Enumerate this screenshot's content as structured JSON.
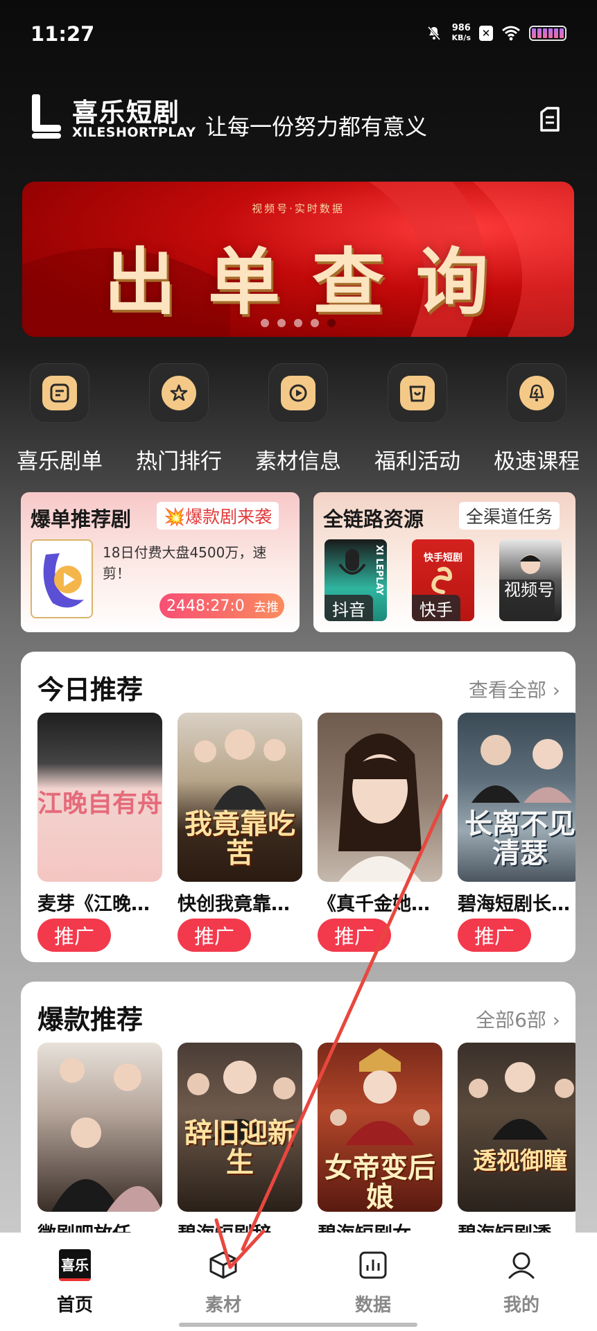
{
  "status_bar": {
    "time": "11:27",
    "net_speed_value": "986",
    "net_speed_unit": "KB/s"
  },
  "header": {
    "logo_cn": "喜乐短剧",
    "logo_en": "XILESHORTPLAY",
    "slogan": "让每一份努力都有意义",
    "notice_icon": "notice-list-icon"
  },
  "banner": {
    "subtitle": "视频号·实时数据",
    "title": "出单查询",
    "dot_count": 5,
    "active_dot": 5
  },
  "quick_nav": [
    {
      "label": "喜乐剧单",
      "icon": "playlist-icon"
    },
    {
      "label": "热门排行",
      "icon": "star-icon"
    },
    {
      "label": "素材信息",
      "icon": "play-icon"
    },
    {
      "label": "福利活动",
      "icon": "gift-bag-icon"
    },
    {
      "label": "极速课程",
      "icon": "bell-icon"
    }
  ],
  "promo_left": {
    "title": "爆单推荐剧",
    "tag": "💥爆款剧来袭",
    "desc": "18日付费大盘4500万，速剪！",
    "timer": "2448:27:0",
    "push_label": "去推"
  },
  "promo_right": {
    "title": "全链路资源",
    "tag": "全渠道任务",
    "channels": [
      {
        "label": "抖音",
        "poster_text": "XI LEPLAY"
      },
      {
        "label": "快手",
        "poster_text": "快手短剧"
      },
      {
        "label": "视频号",
        "poster_text": ""
      }
    ]
  },
  "today": {
    "title": "今日推荐",
    "more": "查看全部",
    "items": [
      {
        "name": "麦芽《江晚…",
        "poster_text": "江晚自有舟",
        "button": "推广"
      },
      {
        "name": "快创我竟靠…",
        "poster_text": "我竟靠吃苦",
        "button": "推广"
      },
      {
        "name": "《真千金她…",
        "poster_text": "",
        "button": "推广"
      },
      {
        "name": "碧海短剧长…",
        "poster_text": "长离不见清瑟",
        "button": "推广"
      }
    ]
  },
  "hot": {
    "title": "爆款推荐",
    "more": "全部6部",
    "items": [
      {
        "name": "微剧吧放任…",
        "poster_text": ""
      },
      {
        "name": "碧海短剧辞…",
        "poster_text": "辞旧迎新生"
      },
      {
        "name": "碧海短剧女…",
        "poster_text": "女帝变后娘"
      },
      {
        "name": "碧海短剧透…",
        "poster_text": "透视御瞳"
      }
    ]
  },
  "bottom_nav": [
    {
      "label": "首页",
      "icon": "home-logo-icon",
      "active": true
    },
    {
      "label": "素材",
      "icon": "box-icon",
      "active": false
    },
    {
      "label": "数据",
      "icon": "chart-icon",
      "active": false
    },
    {
      "label": "我的",
      "icon": "user-icon",
      "active": false
    }
  ],
  "home_logo_text": "喜乐",
  "colors": {
    "accent_gold": "#f4c987",
    "promote_red": "#f3394c",
    "banner_red": "#c30a0a"
  }
}
